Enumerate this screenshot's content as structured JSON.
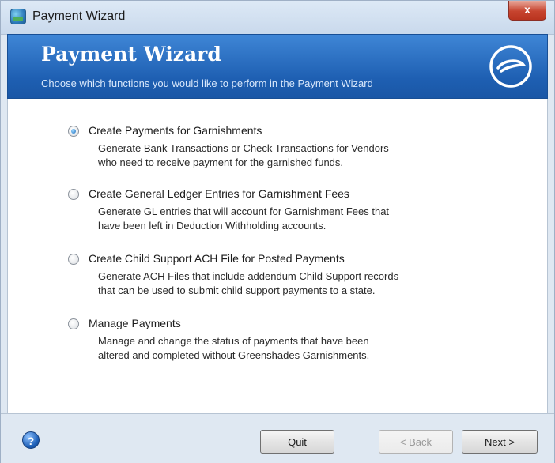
{
  "window": {
    "title": "Payment Wizard",
    "close_label": "x"
  },
  "banner": {
    "title": "Payment Wizard",
    "subtitle": "Choose which functions you would like to perform in the Payment Wizard"
  },
  "options": [
    {
      "label": "Create Payments for Garnishments",
      "desc1": "Generate Bank Transactions or Check Transactions for Vendors",
      "desc2": "who need to receive payment for the garnished funds.",
      "selected": true
    },
    {
      "label": "Create General Ledger Entries for Garnishment Fees",
      "desc1": "Generate GL entries that will account for Garnishment Fees that",
      "desc2": "have been left in Deduction Withholding accounts.",
      "selected": false
    },
    {
      "label": "Create Child Support ACH File for Posted Payments",
      "desc1": "Generate ACH Files that include addendum Child Support records",
      "desc2": "that can be used to submit child support payments to a state.",
      "selected": false
    },
    {
      "label": "Manage Payments",
      "desc1": "Manage and change the status of payments that have been",
      "desc2": "altered and completed without Greenshades Garnishments.",
      "selected": false
    }
  ],
  "footer": {
    "help_glyph": "?",
    "quit_label": "Quit",
    "back_label": "< Back",
    "next_label": "Next >"
  },
  "colors": {
    "banner": "#1e5fb2",
    "close_button": "#c7442f"
  }
}
